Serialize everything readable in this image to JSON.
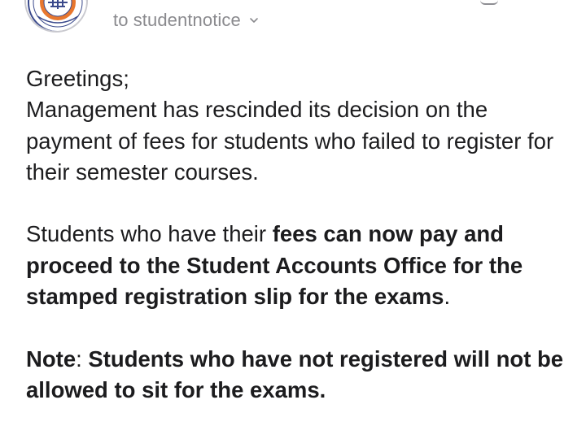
{
  "header": {
    "recipient_prefix": "to",
    "recipient_name": "studentnotice",
    "avatar_icon": "university-crest-logo-icon",
    "accent_color": "#e8772e"
  },
  "message": {
    "greeting": "Greetings;",
    "paragraph1": "Management has rescinded its decision on the payment of fees for students who failed to register for their semester courses.",
    "paragraph2_lead": "Students who have their ",
    "paragraph2_bold": "fees can now pay and proceed to the Student Accounts Office for the stamped registration slip for the exams",
    "paragraph2_end": ".",
    "note_label": "Note",
    "note_colon": ": ",
    "note_text": "Students who have not registered will not be allowed to sit for the exams."
  }
}
